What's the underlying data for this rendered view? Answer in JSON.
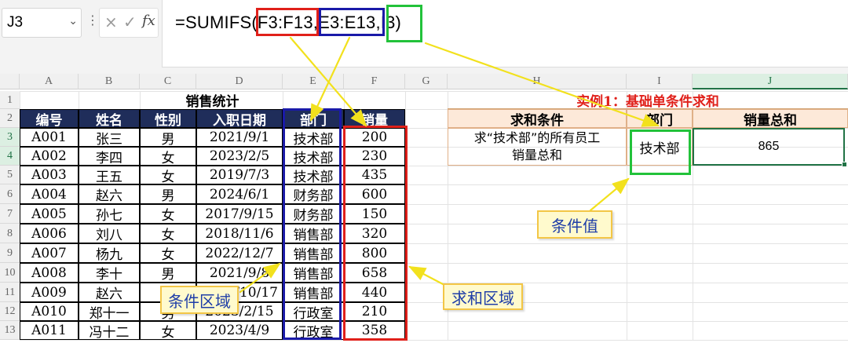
{
  "formula_bar": {
    "name_box": "J3",
    "menu_dots": "⋮",
    "cancel_glyph": "×",
    "enter_glyph": "✓",
    "fx_label": "fx",
    "formula_parts": [
      "=SUMIFS(",
      "F3:F13",
      ",",
      "E3:E13",
      ",",
      "I3",
      ")"
    ]
  },
  "columns": [
    "A",
    "B",
    "C",
    "D",
    "E",
    "F",
    "G",
    "H",
    "I",
    "J"
  ],
  "rows": [
    "1",
    "2",
    "3",
    "4",
    "5",
    "6",
    "7",
    "8",
    "9",
    "10",
    "11",
    "12",
    "13"
  ],
  "table": {
    "title": "销售统计",
    "headers": [
      "编号",
      "姓名",
      "性别",
      "入职日期",
      "部门",
      "销量"
    ],
    "rows": [
      [
        "A001",
        "张三",
        "男",
        "2021/9/1",
        "技术部",
        "200"
      ],
      [
        "A002",
        "李四",
        "女",
        "2023/2/5",
        "技术部",
        "230"
      ],
      [
        "A003",
        "王五",
        "女",
        "2019/7/3",
        "技术部",
        "435"
      ],
      [
        "A004",
        "赵六",
        "男",
        "2024/6/1",
        "财务部",
        "600"
      ],
      [
        "A005",
        "孙七",
        "女",
        "2017/9/15",
        "财务部",
        "150"
      ],
      [
        "A006",
        "刘八",
        "女",
        "2018/11/6",
        "销售部",
        "320"
      ],
      [
        "A007",
        "杨九",
        "女",
        "2022/12/7",
        "销售部",
        "800"
      ],
      [
        "A008",
        "李十",
        "男",
        "2021/9/8",
        "销售部",
        "658"
      ],
      [
        "A009",
        "赵六",
        "女",
        "2023/10/17",
        "销售部",
        "440"
      ],
      [
        "A010",
        "郑十一",
        "男",
        "2023/2/15",
        "行政室",
        "210"
      ],
      [
        "A011",
        "冯十二",
        "女",
        "2023/4/9",
        "行政室",
        "358"
      ]
    ]
  },
  "example": {
    "title": "实例1：基础单条件求和",
    "headers": [
      "求和条件",
      "部门",
      "销量总和"
    ],
    "condition_text_line1": "求“技术部”的所有员工",
    "condition_text_line2": "销量总和",
    "department": "技术部",
    "result": "865"
  },
  "callouts": {
    "condition_range": "条件区域",
    "sum_range": "求和区域",
    "condition_value": "条件值"
  },
  "colors": {
    "header_navy": "#1f2d5a",
    "red": "#e0201a",
    "blue": "#1a1aa8",
    "green": "#22c23a",
    "arrow_yellow": "#f2e11d",
    "callout_bg": "#fffacd",
    "example_header_bg": "#fde9d9"
  }
}
